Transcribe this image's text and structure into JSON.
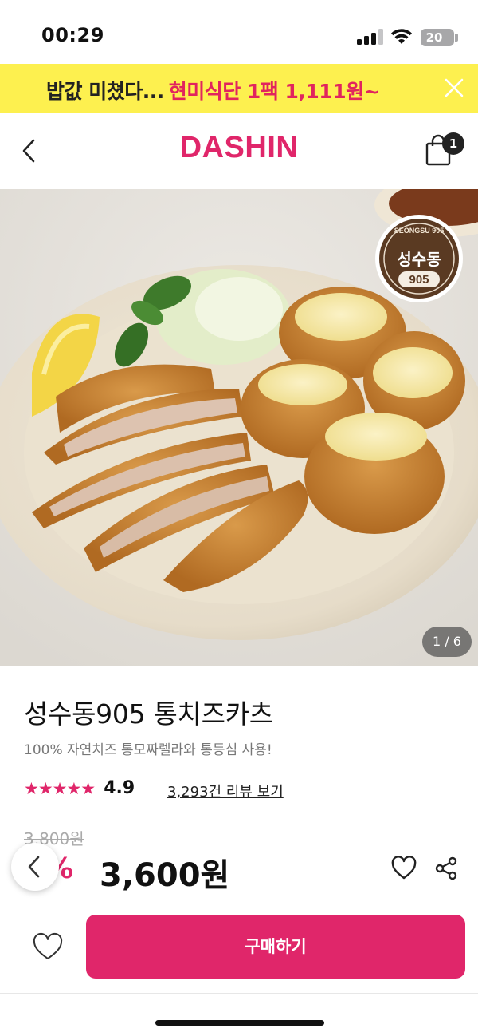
{
  "status": {
    "time": "00:29",
    "battery": "20",
    "battery_level": 0.2
  },
  "promo": {
    "text_main": "밥값 미쳤다...",
    "text_accent": "현미식단 1팩 1,111원~",
    "close_icon": "close-icon"
  },
  "nav": {
    "brand": "DASHIN",
    "cart_count": "1",
    "back_icon": "chevron-left-icon",
    "cart_icon": "shopping-bag-icon"
  },
  "gallery": {
    "counter": "1 / 6",
    "badge_top": "SEONGSU 905",
    "badge_name": "성수동",
    "badge_num": "905"
  },
  "product": {
    "title": "성수동905 통치즈카츠",
    "subtitle": "100% 자연치즈 통모짜렐라와 통등심 사용!",
    "stars": "★★★★★",
    "rating": "4.9",
    "review_link": "3,293건 리뷰 보기",
    "original_price": "3,800원",
    "discount": "%",
    "sale_price": "3,600원"
  },
  "actions": {
    "buy_label": "구매하기"
  },
  "colors": {
    "brand": "#e0266a",
    "promo_bg": "#fdf04f"
  }
}
